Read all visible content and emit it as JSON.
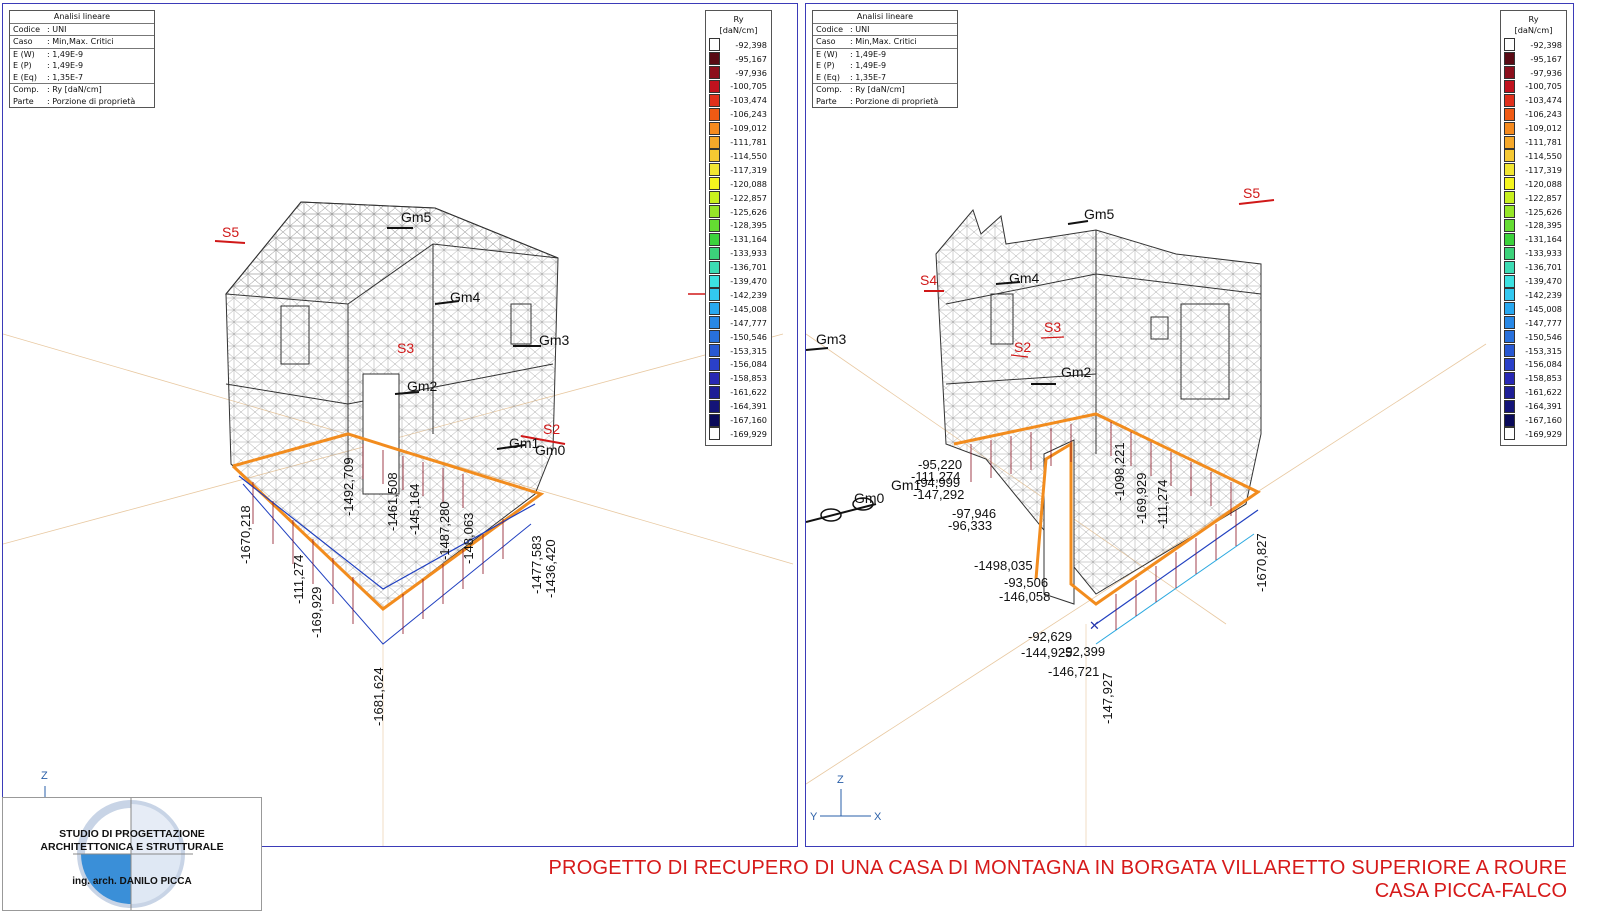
{
  "info_box": {
    "title": "Analisi lineare",
    "rows": [
      {
        "k": "Codice",
        "v": ": UNI"
      },
      {
        "k": "Caso",
        "v": ": Min,Max. Critici"
      },
      {
        "k": "E (W)",
        "v": ": 1,49E-9"
      },
      {
        "k": "E (P)",
        "v": ": 1,49E-9"
      },
      {
        "k": "E (Eq)",
        "v": ": 1,35E-7"
      },
      {
        "k": "Comp.",
        "v": ": Ry [daN/cm]"
      },
      {
        "k": "Parte",
        "v": ": Porzione di proprietà"
      }
    ]
  },
  "legend": {
    "title_line1": "Ry",
    "title_line2": "[daN/cm]",
    "entries": [
      {
        "value": "-92,398",
        "color": "#ffffff"
      },
      {
        "value": "-95,167",
        "color": "#5a0a14"
      },
      {
        "value": "-97,936",
        "color": "#8c0f1c"
      },
      {
        "value": "-100,705",
        "color": "#c0121e"
      },
      {
        "value": "-103,474",
        "color": "#e0301c"
      },
      {
        "value": "-106,243",
        "color": "#f05a14"
      },
      {
        "value": "-109,012",
        "color": "#f58a1e"
      },
      {
        "value": "-111,781",
        "color": "#f5a82a"
      },
      {
        "value": "-114,550",
        "color": "#f5c832"
      },
      {
        "value": "-117,319",
        "color": "#f2e632"
      },
      {
        "value": "-120,088",
        "color": "#f5f51e"
      },
      {
        "value": "-122,857",
        "color": "#c8f01e"
      },
      {
        "value": "-125,626",
        "color": "#96e628"
      },
      {
        "value": "-128,395",
        "color": "#64dc32"
      },
      {
        "value": "-131,164",
        "color": "#3cd23c"
      },
      {
        "value": "-133,933",
        "color": "#3cd27a"
      },
      {
        "value": "-136,701",
        "color": "#3cdcb4"
      },
      {
        "value": "-139,470",
        "color": "#3ce1e1"
      },
      {
        "value": "-142,239",
        "color": "#32c8f0"
      },
      {
        "value": "-145,008",
        "color": "#28a8f0"
      },
      {
        "value": "-147,777",
        "color": "#2888e6"
      },
      {
        "value": "-150,546",
        "color": "#2870dc"
      },
      {
        "value": "-153,315",
        "color": "#2858d2"
      },
      {
        "value": "-156,084",
        "color": "#2a40c8"
      },
      {
        "value": "-158,853",
        "color": "#2828b4"
      },
      {
        "value": "-161,622",
        "color": "#1e1e96"
      },
      {
        "value": "-164,391",
        "color": "#141478"
      },
      {
        "value": "-167,160",
        "color": "#0a0a5a"
      },
      {
        "value": "-169,929",
        "color": "#ffffff"
      }
    ]
  },
  "left_view": {
    "labels": {
      "S5": "S5",
      "S3": "S3",
      "S2": "S2",
      "Gm5": "Gm5",
      "Gm4": "Gm4",
      "Gm3": "Gm3",
      "Gm2": "Gm2",
      "Gm1": "Gm1",
      "Gm0": "Gm0"
    },
    "values": [
      "-1670,218",
      "-111,274",
      "-169,929",
      "-1492,709",
      "-1461,508",
      "-145,164",
      "-1487,280",
      "-148,063",
      "-1477,583",
      "-1436,420",
      "-1681,624"
    ],
    "axis": {
      "z": "Z"
    }
  },
  "right_view": {
    "labels": {
      "S5": "S5",
      "S4": "S4",
      "S3": "S3",
      "S2": "S2",
      "Gm5": "Gm5",
      "Gm4": "Gm4",
      "Gm3": "Gm3",
      "Gm2": "Gm2",
      "Gm1": "Gm1",
      "Gm0": "Gm0"
    },
    "values": [
      "-95,220",
      "-111,274",
      "-94,999",
      "-147,292",
      "-97,946",
      "-96,333",
      "-1498,035",
      "-93,506",
      "-146,058",
      "-1098,221",
      "-169,929",
      "-111,274",
      "-1670,827",
      "-92,629",
      "-144,925",
      "-92,399",
      "-146,721",
      "-147,927"
    ],
    "axis": {
      "z": "Z",
      "y": "Y",
      "x": "X"
    }
  },
  "logo": {
    "line1": "STUDIO DI PROGETTAZIONE",
    "line2": "ARCHITETTONICA E STRUTTURALE",
    "line3": "ing. arch. DANILO PICCA"
  },
  "footer": {
    "title": "PROGETTO DI RECUPERO DI UNA CASA DI MONTAGNA IN BORGATA VILLARETTO SUPERIORE A ROURE",
    "subtitle": "CASA PICCA-FALCO"
  }
}
